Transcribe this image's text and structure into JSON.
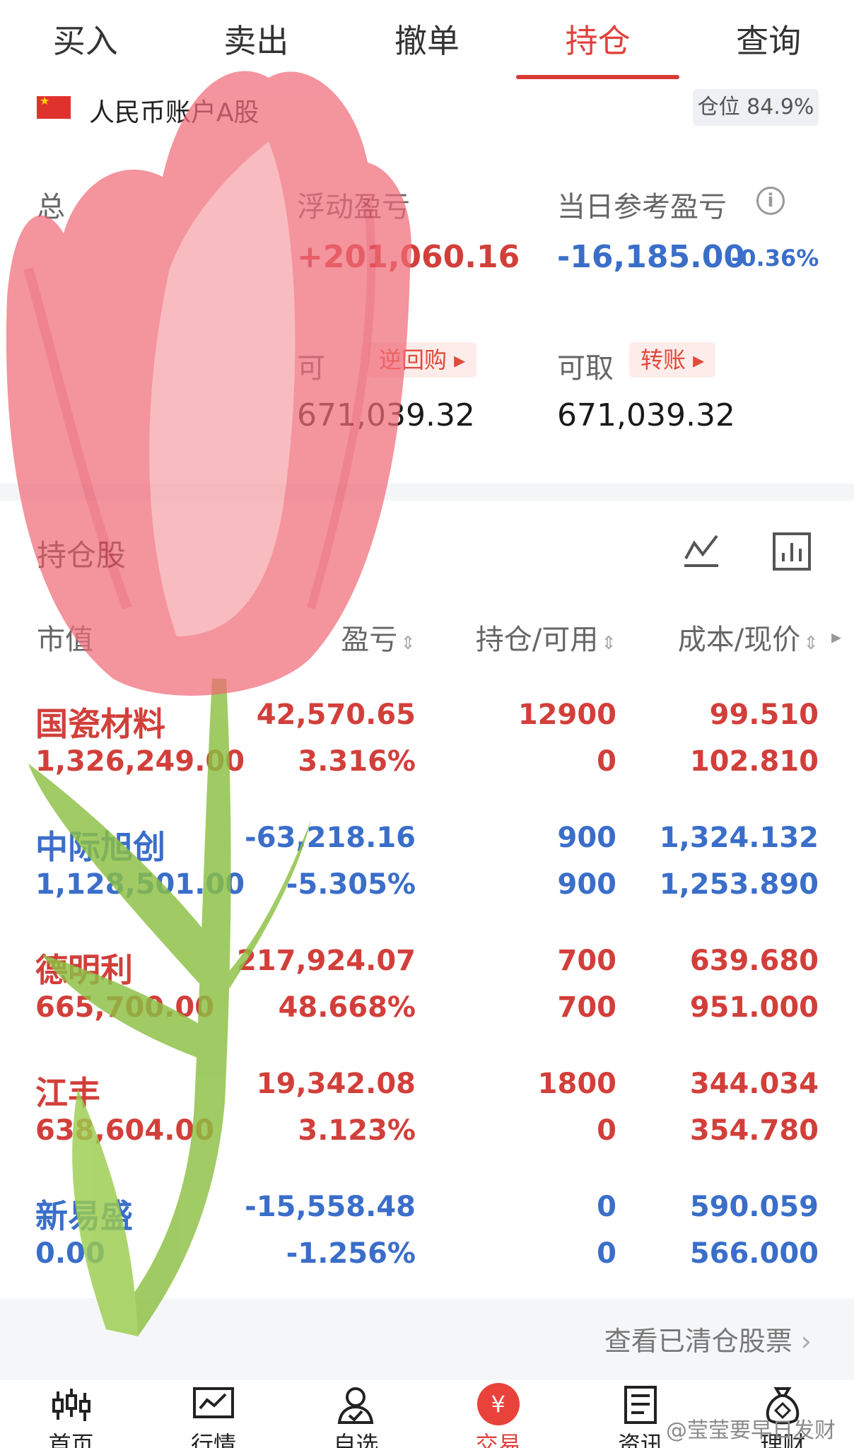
{
  "tabs": [
    {
      "label": "买入"
    },
    {
      "label": "卖出"
    },
    {
      "label": "撤单"
    },
    {
      "label": "持仓"
    },
    {
      "label": "查询"
    }
  ],
  "account": {
    "name": "人民币账户A股",
    "position_label": "仓位 84.9%"
  },
  "summary": {
    "total_assets_label": "总",
    "floating_pnl_label": "浮动盈亏",
    "floating_pnl_value": "+201,060.16",
    "daily_pnl_label": "当日参考盈亏",
    "daily_pnl_value": "-16,185.00",
    "daily_pnl_pct": "-0.36%",
    "available_label": "可",
    "repo_button": "逆回购 ▸",
    "available_value": "671,039.32",
    "withdrawable_label": "可取",
    "transfer_button": "转账 ▸",
    "withdrawable_value": "671,039.32"
  },
  "holdings": {
    "title": "持仓股",
    "columns": {
      "market_value": "市值",
      "pnl": "盈亏",
      "position": "持仓/可用",
      "cost_price": "成本/现价"
    },
    "rows": [
      {
        "name": "国瓷材料",
        "market_value": "1,326,249.00",
        "pnl": "42,570.65",
        "pnl_pct": "3.316%",
        "hold": "12900",
        "avail": "0",
        "cost": "99.510",
        "price": "102.810",
        "color": "red"
      },
      {
        "name": "中际旭创",
        "market_value": "1,128,501.00",
        "pnl": "-63,218.16",
        "pnl_pct": "-5.305%",
        "hold": "900",
        "avail": "900",
        "cost": "1,324.132",
        "price": "1,253.890",
        "color": "blue"
      },
      {
        "name": "德明利",
        "market_value": "665,700.00",
        "pnl": "217,924.07",
        "pnl_pct": "48.668%",
        "hold": "700",
        "avail": "700",
        "cost": "639.680",
        "price": "951.000",
        "color": "red"
      },
      {
        "name": "江丰",
        "market_value": "638,604.00",
        "pnl": "19,342.08",
        "pnl_pct": "3.123%",
        "hold": "1800",
        "avail": "0",
        "cost": "344.034",
        "price": "354.780",
        "color": "red"
      },
      {
        "name": "新易盛",
        "market_value": "0.00",
        "pnl": "-15,558.48",
        "pnl_pct": "-1.256%",
        "hold": "0",
        "avail": "0",
        "cost": "590.059",
        "price": "566.000",
        "color": "blue"
      }
    ]
  },
  "cleared_link": "查看已清仓股票",
  "nav": [
    {
      "label": "首页",
      "icon": "candlestick-icon"
    },
    {
      "label": "行情",
      "icon": "market-chart-icon"
    },
    {
      "label": "自选",
      "icon": "person-check-icon"
    },
    {
      "label": "交易",
      "icon": "yuan-coin-icon",
      "symbol": "¥"
    },
    {
      "label": "资讯",
      "icon": "news-document-icon"
    },
    {
      "label": "理财",
      "icon": "money-bag-icon"
    }
  ],
  "watermark": "@莹莹要早日发财",
  "colors": {
    "accent_red": "#d23f3a",
    "loss_blue": "#3a6ec9",
    "tulip_pink": "#f06b78",
    "stem_green": "#8cc043"
  }
}
